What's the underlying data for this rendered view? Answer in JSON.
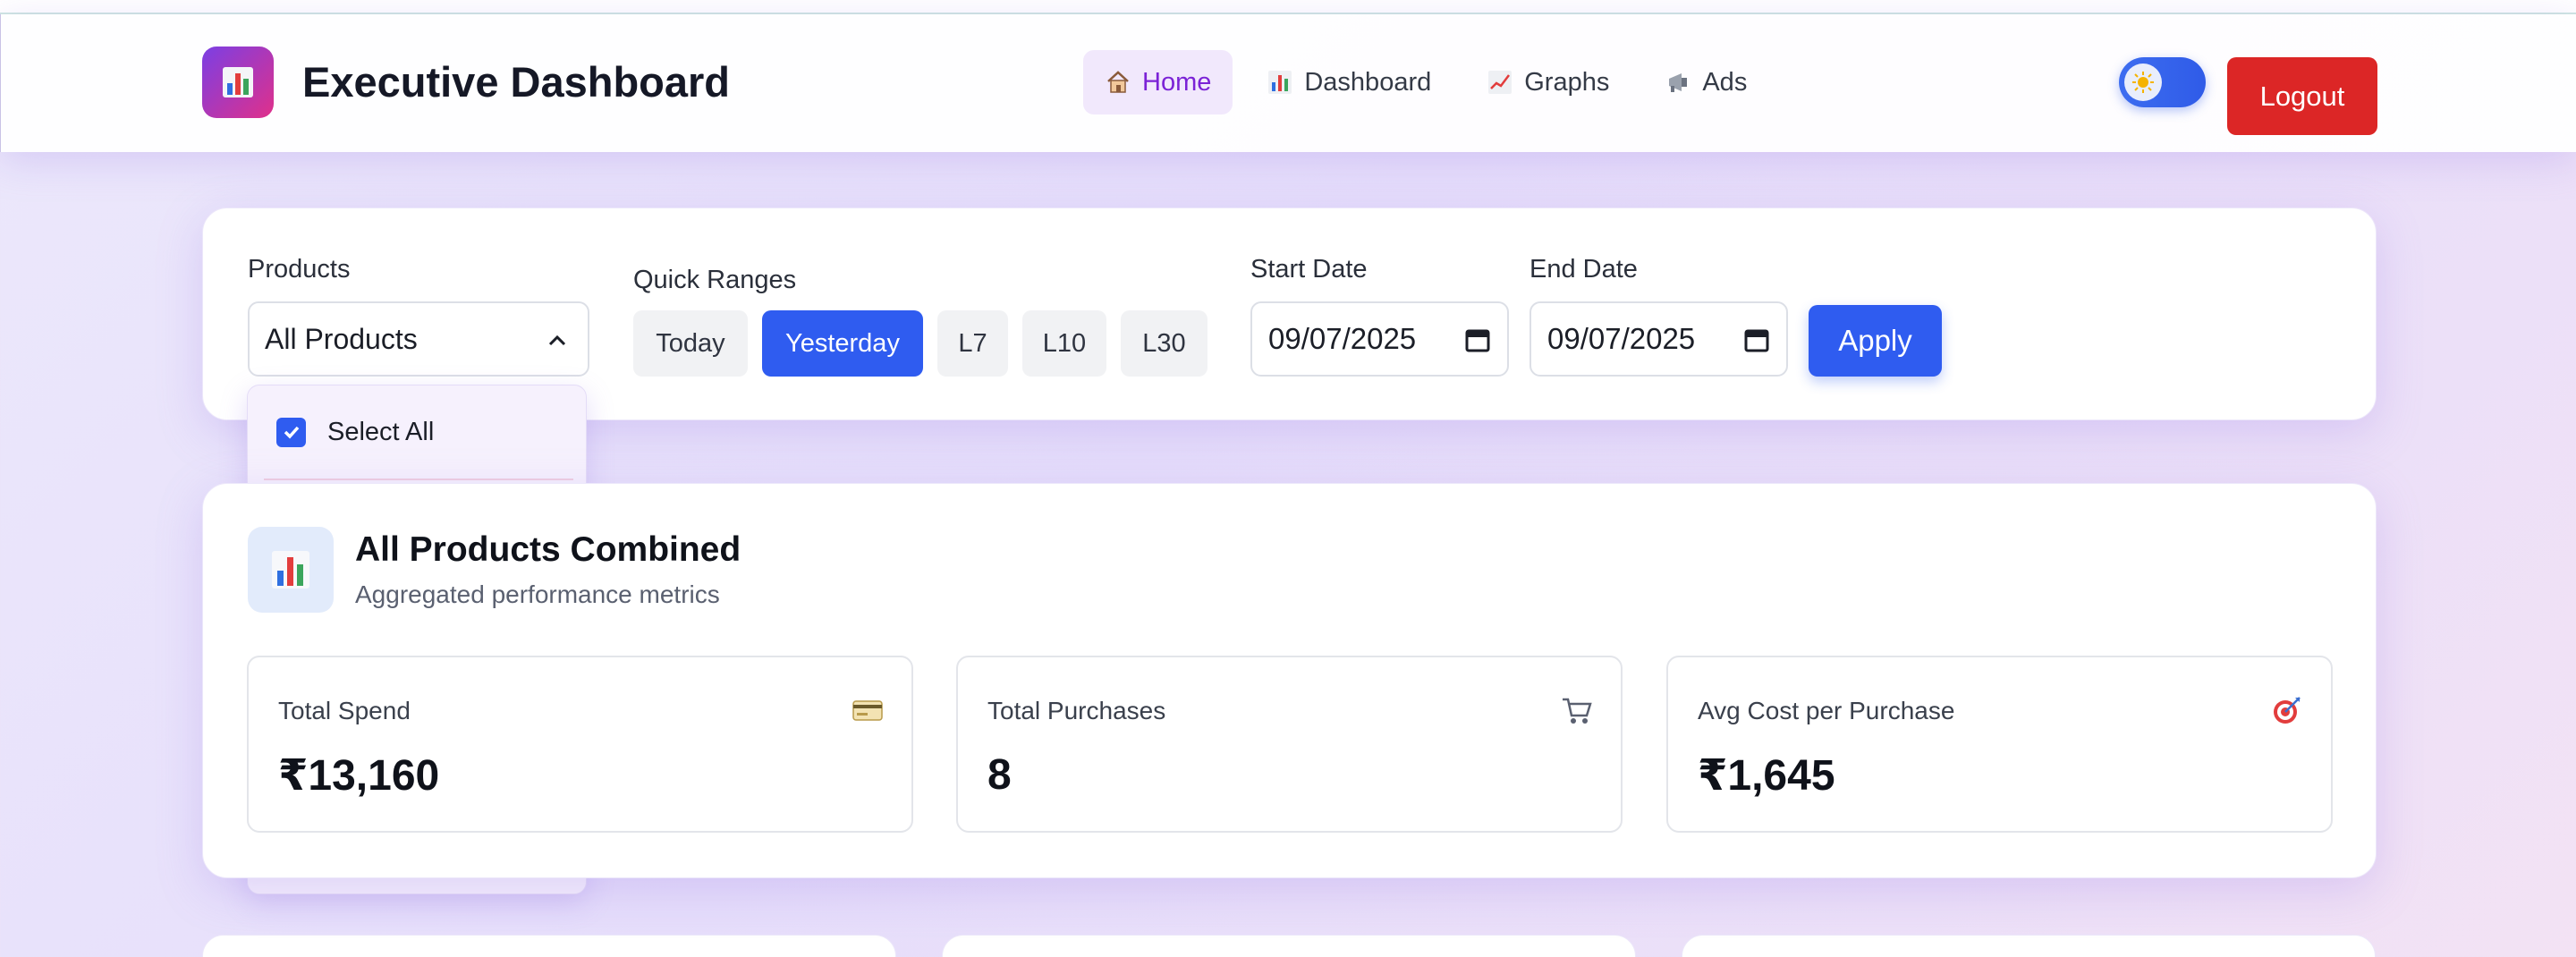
{
  "header": {
    "title": "Executive Dashboard",
    "logo_icon": "bar-chart-icon",
    "nav": [
      {
        "label": "Home",
        "icon": "house-icon",
        "active": true
      },
      {
        "label": "Dashboard",
        "icon": "bar-chart-icon",
        "active": false
      },
      {
        "label": "Graphs",
        "icon": "trend-chart-icon",
        "active": false
      },
      {
        "label": "Ads",
        "icon": "megaphone-icon",
        "active": false
      }
    ],
    "theme_toggle_icon": "sun-icon",
    "logout_label": "Logout"
  },
  "filters": {
    "products_label": "Products",
    "products_value": "All Products",
    "quick_ranges_label": "Quick Ranges",
    "quick_ranges": [
      "Today",
      "Yesterday",
      "L7",
      "L10",
      "L30"
    ],
    "active_range": "Yesterday",
    "start_date_label": "Start Date",
    "start_date": "09/07/2025",
    "end_date_label": "End Date",
    "end_date": "09/07/2025",
    "apply_label": "Apply",
    "dropdown": {
      "select_all_label": "Select All",
      "select_all_checked": true
    }
  },
  "summary": {
    "title": "All Products Combined",
    "subtitle": "Aggregated performance metrics",
    "metrics": [
      {
        "label": "Total Spend",
        "value": "₹13,160",
        "icon": "credit-card-icon"
      },
      {
        "label": "Total Purchases",
        "value": "8",
        "icon": "shopping-cart-icon"
      },
      {
        "label": "Avg Cost per Purchase",
        "value": "₹1,645",
        "icon": "target-icon"
      }
    ]
  },
  "colors": {
    "accent_blue": "#2f5cf0",
    "nav_active": "#7b22d6",
    "logout_red": "#dc2626"
  }
}
